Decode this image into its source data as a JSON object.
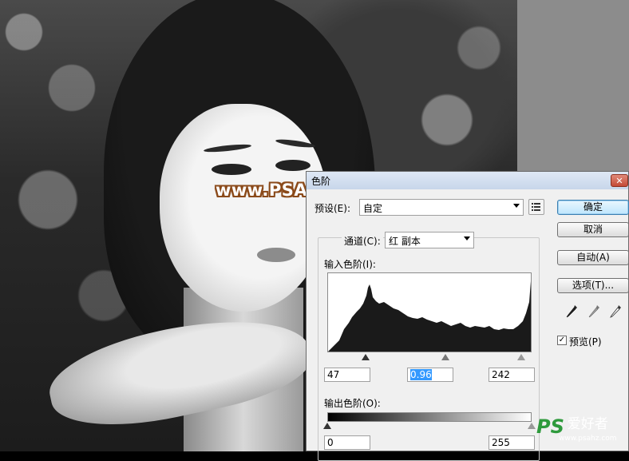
{
  "watermark": "www.PSALL.com",
  "dialog": {
    "title": "色阶",
    "close": "✕",
    "preset_label": "预设(E):",
    "preset_value": "自定",
    "channel_label": "通道(C):",
    "channel_value": "红 副本",
    "input_label": "输入色阶(I):",
    "input_values": [
      "47",
      "0.96",
      "242"
    ],
    "output_label": "输出色阶(O):",
    "output_values": [
      "0",
      "255"
    ],
    "buttons": {
      "ok": "确定",
      "cancel": "取消",
      "auto": "自动(A)",
      "options": "选项(T)..."
    },
    "preview_label": "预览(P)",
    "preview_checked": "✓"
  },
  "logo": {
    "ps": "PS",
    "chinese": "爱好者",
    "url": "www.psahz.com"
  },
  "histogram_color": "#1a1a1a"
}
